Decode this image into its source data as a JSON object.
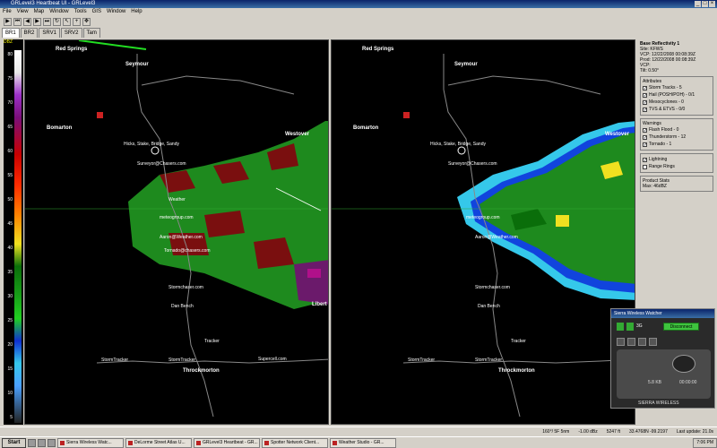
{
  "window": {
    "title": "GRLevel3 Heartbeat UI - GRLevel3",
    "controls": [
      "_",
      "□",
      "×"
    ]
  },
  "menu": [
    "File",
    "View",
    "Map",
    "Window",
    "Tools",
    "GIS",
    "Window",
    "Help"
  ],
  "toolbar_icons": [
    "play",
    "first",
    "prev",
    "next",
    "last",
    "loop",
    "cursor",
    "zoom",
    "pan"
  ],
  "tabs": [
    "BR1",
    "BR2",
    "SRV1",
    "SRV2",
    "Tam"
  ],
  "scale": {
    "unit": "DBZ",
    "ticks": [
      "80",
      "75",
      "70",
      "65",
      "60",
      "55",
      "50",
      "45",
      "40",
      "35",
      "30",
      "25",
      "20",
      "15",
      "10",
      "5"
    ]
  },
  "cities": {
    "red_springs": "Red Springs",
    "seymour": "Seymour",
    "bomarton": "Bomarton",
    "westover": "Westover",
    "throckmorton": "Throckmorton",
    "libert": "Libert"
  },
  "spotters": {
    "top": "Hicks, Stake, Bridge, Sandy",
    "mid": "Surveyor@Chasers.com",
    "mid2": "Weather",
    "mid3": "meteogroup.com",
    "lower": "Aaron@Weather.com",
    "lower2": "Tornado@chasers.com",
    "bottom": "Stormchaser.com",
    "dan": "Dan Bench",
    "tracker1": "StormTracker",
    "tracker2": "StormTracker",
    "low": "Tracker",
    "right": "Supercell.com"
  },
  "panel": {
    "title": "Base Reflectivity 1",
    "lines": [
      "Site: KFWS",
      "VCP: 12/22/2008 00:08:39Z",
      "Prod: 12/22/2008 00:08:39Z",
      "VCP:",
      "Tilt: 0.50°"
    ],
    "attributes_title": "Attributes",
    "attributes": [
      "Storm Tracks - 5",
      "Hail (POSH/POH) - 0/1",
      "Mesocyclones - 0",
      "TVS & ETVS - 0/0"
    ],
    "warnings_title": "Warnings",
    "warnings": [
      "Flash Flood - 0",
      "Thunderstorm - 12",
      "Tornado - 1"
    ],
    "options": [
      "Lightning",
      "Range Rings"
    ],
    "product_title": "Product Stats",
    "product_value": "Max: 46dBZ"
  },
  "popup": {
    "title": "Sierra Wireless Watcher",
    "connect": "Disconnect",
    "signal": "3G",
    "carrier": "SIERRA WIRELESS",
    "speed": "5.8 KB",
    "time": "00:00:00"
  },
  "status": {
    "left": "160°/ 5F 5nm",
    "center": "-1.00 dBz",
    "coords": "5247 ft",
    "latlon": "33.4768N -99.2197",
    "last": "Last update: 21.0s"
  },
  "taskbar": {
    "start": "Start",
    "items": [
      "Sierra Wireless Watc...",
      "DeLorme Street Atlas U...",
      "GRLevel3 Heartbeat - GR...",
      "Spotter Network Client...",
      "Weather Studio - GR..."
    ],
    "clock": "7:06 PM"
  },
  "colors": {
    "bg": "#000000",
    "green": "#1e8a1e",
    "darkred": "#7a0f0f",
    "cyan": "#35c8ea",
    "blue": "#1144dd",
    "yellow": "#f0e020"
  }
}
